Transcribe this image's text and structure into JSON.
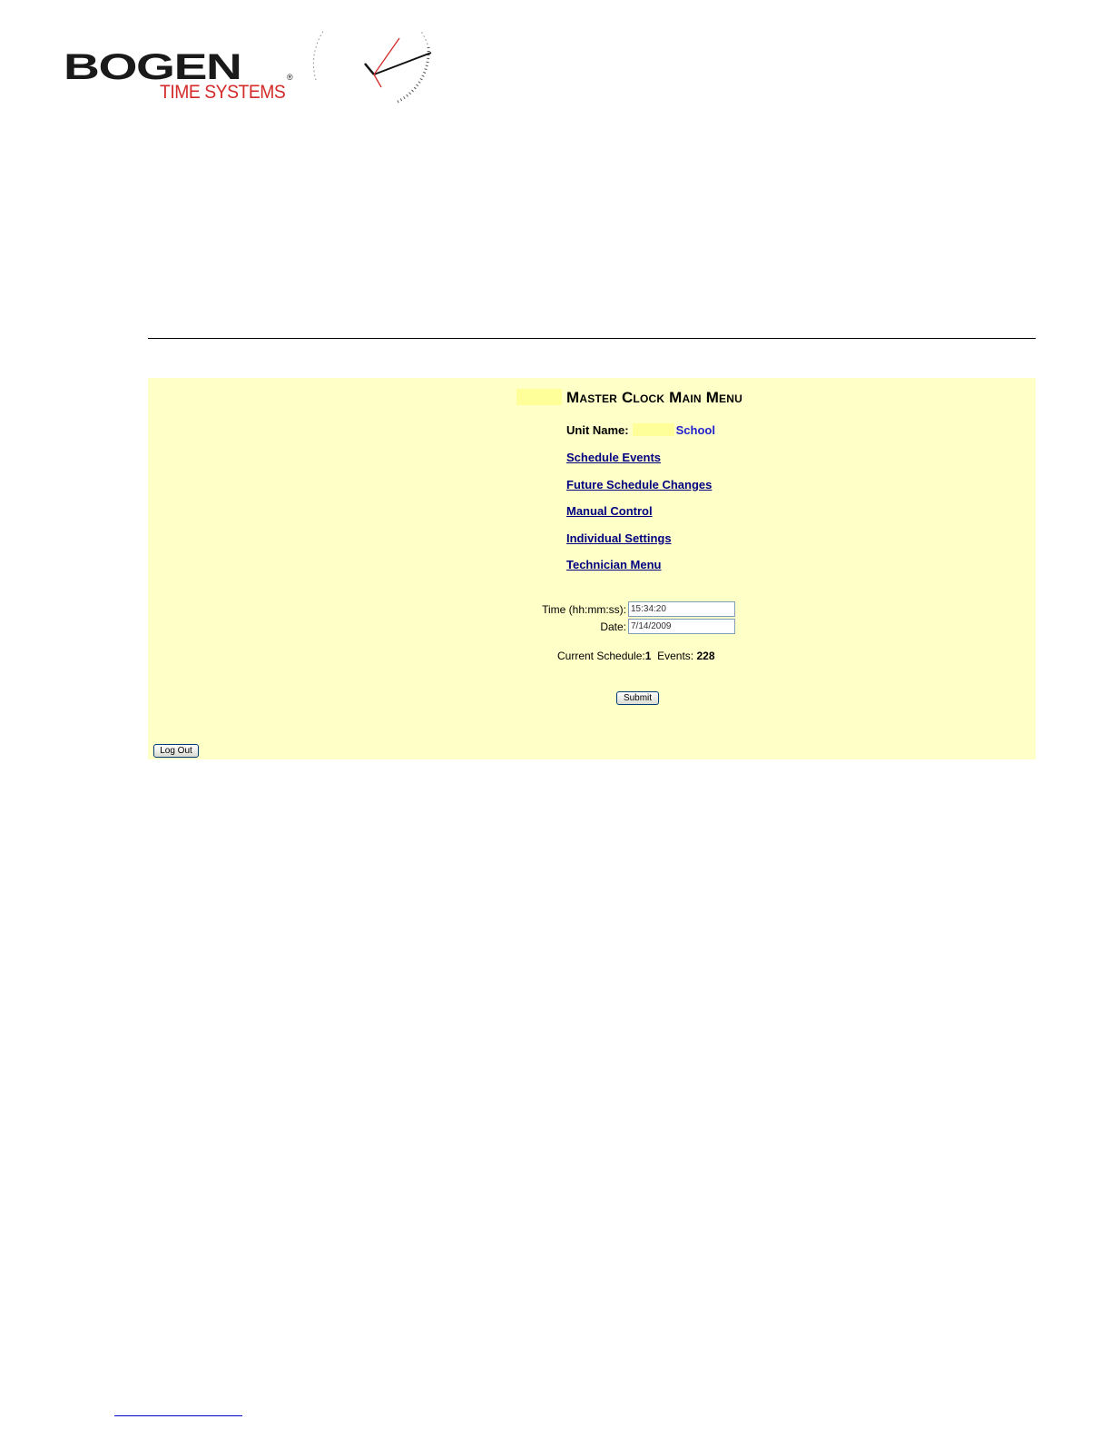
{
  "logo": {
    "brand": "BOGEN",
    "registered": "®",
    "tagline": "TIME SYSTEMS"
  },
  "menu": {
    "title": "Master Clock Main Menu",
    "unit_name_label": "Unit Name:",
    "unit_name_value": "School",
    "links": [
      "Schedule Events",
      "Future Schedule Changes",
      "Manual Control",
      "Individual Settings",
      "Technician Menu"
    ]
  },
  "form": {
    "time_label": "Time (hh:mm:ss):",
    "time_value": "15:34:20",
    "date_label": "Date:",
    "date_value": "7/14/2009",
    "schedule_label": "Current Schedule:",
    "schedule_value": "1",
    "events_label": "Events:",
    "events_value": "228"
  },
  "buttons": {
    "submit": "Submit",
    "logout": "Log Out"
  },
  "colors": {
    "panel_bg": "#ffffc8",
    "link": "#000080",
    "unit_value": "#2222cc",
    "logo_red": "#d42a2a"
  }
}
